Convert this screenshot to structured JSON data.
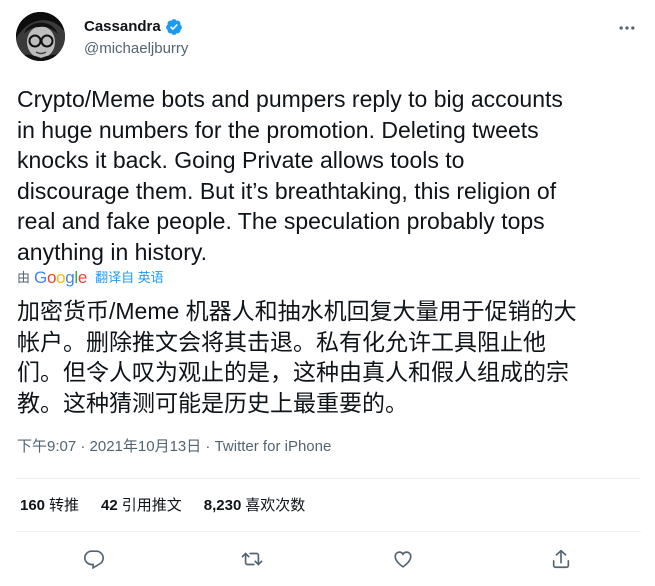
{
  "author": {
    "name": "Cassandra",
    "handle": "@michaeljburry",
    "verified": true
  },
  "tweet": {
    "text_en": "Crypto/Meme bots and pumpers reply to big accounts\nin huge numbers for the promotion. Deleting tweets\nknocks it back. Going Private allows tools to\ndiscourage them. But it’s breathtaking, this religion of\nreal and fake people. The speculation probably tops\nanything in history.",
    "translated_by_prefix": "由",
    "translated_by_brand": "Google",
    "translated_from_label": "翻译自 英语",
    "text_zh": "加密货币/Meme 机器人和抽水机回复大量用于促销的大\n帐户。删除推文会将其击退。私有化允许工具阻止他\n们。但令人叹为观止的是，这种由真人和假人组成的宗\n教。这种猜测可能是历史上最重要的。",
    "meta": "下午9:07 · 2021年10月13日 · Twitter for iPhone"
  },
  "stats": {
    "retweets_count": "160",
    "retweets_label": "转推",
    "quotes_count": "42",
    "quotes_label": "引用推文",
    "likes_count": "8,230",
    "likes_label": "喜欢次数"
  },
  "colors": {
    "text": "#0f1419",
    "secondary": "#536471",
    "accent": "#1d9bf0",
    "divider": "#eff3f4"
  },
  "icons": [
    "verified-badge-icon",
    "more-icon",
    "reply-icon",
    "retweet-icon",
    "like-icon",
    "share-icon"
  ]
}
